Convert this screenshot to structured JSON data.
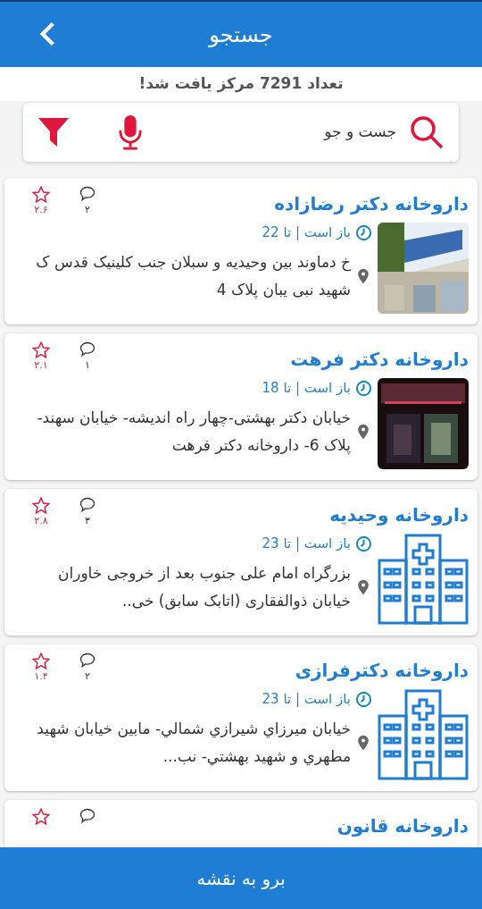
{
  "header": {
    "title": "جستجو"
  },
  "result_count": "تعداد 7291 مرکز یافت شد!",
  "search": {
    "placeholder": "جست و جو"
  },
  "results": [
    {
      "title": "داروخانه دکتر رضازاده",
      "comments": "۲",
      "rating": "۲.۶",
      "hours": "باز است | تا 22",
      "address": "خ دماوند بین وحیدیه و سبلان جنب کلینیک قدس ک شهید نبی یبان پلاک 4"
    },
    {
      "title": "داروخانه دکتر فرهت",
      "comments": "۱",
      "rating": "۲.۱",
      "hours": "باز است | تا 18",
      "address": "خیابان دکتر بهشتی-چهار راه اندیشه- خیابان سهند- پلاک 6- داروخانه دکتر فرهت"
    },
    {
      "title": "داروخانه  وحیدیه",
      "comments": "۳",
      "rating": "۲.۸",
      "hours": "باز است | تا 23",
      "address": "بزرگراه امام علی جنوب بعد از خروجی خاوران خیابان ذوالفقاری (اتابک سابق) خی..",
      "image": {
        "kind": "building"
      }
    },
    {
      "title": "داروخانه دکترفرازی",
      "comments": "۲",
      "rating": "۱.۴",
      "hours": "باز است | تا 23",
      "address": "خيابان ميرزاي  شيرازي شمالي- مابين خيابان شهيد مطهري و شهيد بهشتي- نب...",
      "image": {
        "kind": "building"
      }
    },
    {
      "title": "داروخانه قانون"
    }
  ],
  "bottom_button": "برو به نقشه"
}
